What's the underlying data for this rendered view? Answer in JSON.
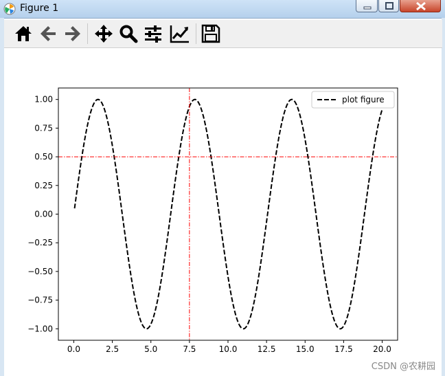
{
  "window": {
    "title": "Figure 1"
  },
  "toolbar": {
    "buttons": [
      {
        "name": "home-button",
        "icon": "home-icon"
      },
      {
        "name": "back-button",
        "icon": "arrow-left-icon"
      },
      {
        "name": "forward-button",
        "icon": "arrow-right-icon"
      },
      {
        "name": "pan-button",
        "icon": "move-icon"
      },
      {
        "name": "zoom-button",
        "icon": "magnifier-icon"
      },
      {
        "name": "configure-subplots-button",
        "icon": "sliders-icon"
      },
      {
        "name": "edit-axis-button",
        "icon": "line-chart-icon"
      },
      {
        "name": "save-button",
        "icon": "floppy-disk-icon"
      }
    ]
  },
  "chart_data": {
    "type": "line",
    "function": "sin(x)",
    "x_range": [
      0.05,
      20.0
    ],
    "xlim": [
      -1.0,
      21.0
    ],
    "ylim": [
      -1.1,
      1.1
    ],
    "xticks": [
      0.0,
      2.5,
      5.0,
      7.5,
      10.0,
      12.5,
      15.0,
      17.5,
      20.0
    ],
    "xtick_labels": [
      "0.0",
      "2.5",
      "5.0",
      "7.5",
      "10.0",
      "12.5",
      "15.0",
      "17.5",
      "20.0"
    ],
    "yticks": [
      1.0,
      0.75,
      0.5,
      0.25,
      0.0,
      -0.25,
      -0.5,
      -0.75,
      -1.0
    ],
    "ytick_labels": [
      "1.00",
      "0.75",
      "0.50",
      "0.25",
      "0.00",
      "−0.25",
      "−0.50",
      "−0.75",
      "−1.00"
    ],
    "series": [
      {
        "name": "plot figure",
        "color": "#000000",
        "style": "dashed"
      }
    ],
    "hline": {
      "y": 0.5,
      "color": "#ff0000",
      "style": "dashdot"
    },
    "vline": {
      "x": 7.5,
      "color": "#ff0000",
      "style": "dashdot"
    },
    "legend": {
      "position": "top-right",
      "label": "plot figure"
    },
    "grid": false
  },
  "watermark": "CSDN @农耕园"
}
